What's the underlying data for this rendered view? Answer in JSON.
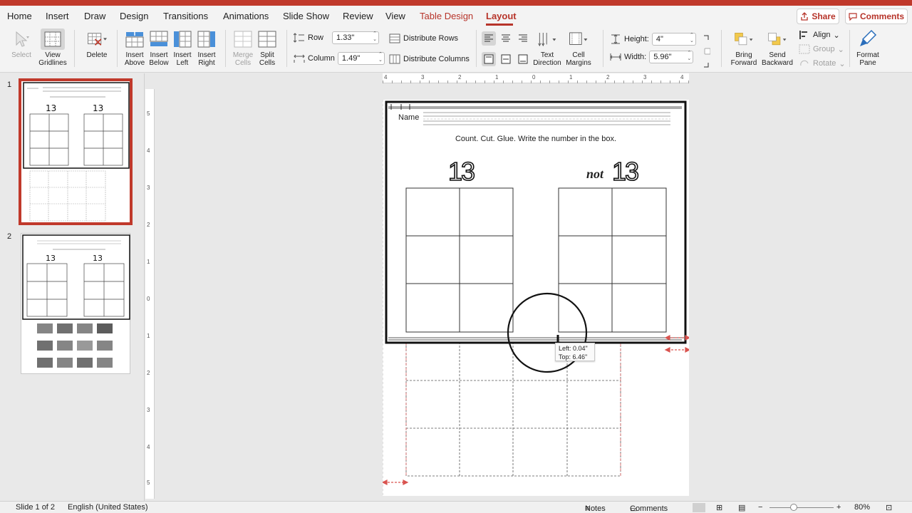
{
  "tabs": [
    "Home",
    "Insert",
    "Draw",
    "Design",
    "Transitions",
    "Animations",
    "Slide Show",
    "Review",
    "View",
    "Table Design",
    "Layout"
  ],
  "header": {
    "share": "Share",
    "comments": "Comments"
  },
  "ribbon": {
    "select": "Select",
    "view_gridlines": [
      "View",
      "Gridlines"
    ],
    "delete": "Delete",
    "insert_above": [
      "Insert",
      "Above"
    ],
    "insert_below": [
      "Insert",
      "Below"
    ],
    "insert_left": [
      "Insert",
      "Left"
    ],
    "insert_right": [
      "Insert",
      "Right"
    ],
    "merge_cells": [
      "Merge",
      "Cells"
    ],
    "split_cells": [
      "Split",
      "Cells"
    ],
    "row_label": "Row",
    "row_value": "1.33\"",
    "column_label": "Column",
    "column_value": "1.49\"",
    "distribute_rows": "Distribute Rows",
    "distribute_columns": "Distribute Columns",
    "text_direction": [
      "Text",
      "Direction"
    ],
    "cell_margins": [
      "Cell",
      "Margins"
    ],
    "height_label": "Height:",
    "height_value": "4\"",
    "width_label": "Width:",
    "width_value": "5.96\"",
    "bring_forward": [
      "Bring",
      "Forward"
    ],
    "send_backward": [
      "Send",
      "Backward"
    ],
    "align": "Align",
    "group": "Group",
    "rotate": "Rotate",
    "format_pane": [
      "Format",
      "Pane"
    ]
  },
  "slides_panel": {
    "numbers": [
      "1",
      "2"
    ]
  },
  "ruler": {
    "h": [
      "4",
      "3",
      "2",
      "1",
      "0",
      "1",
      "2",
      "3",
      "4"
    ],
    "v": [
      "5",
      "4",
      "3",
      "2",
      "1",
      "0",
      "1",
      "2",
      "3",
      "4",
      "5"
    ]
  },
  "slide": {
    "name_label": "Name",
    "instruction": "Count.  Cut.  Glue.  Write the number in the box.",
    "number_left": "13",
    "not_word": "not",
    "number_right": "13",
    "tooltip_left": "Left: 0.04\"",
    "tooltip_top": "Top: 6.46\""
  },
  "statusbar": {
    "slide_info": "Slide 1 of 2",
    "language": "English (United States)",
    "notes": "Notes",
    "comments": "Comments",
    "zoom": "80%"
  },
  "colors": {
    "accent": "#b7342a",
    "titlebar": "#c0392b",
    "guide": "#d9534f"
  }
}
